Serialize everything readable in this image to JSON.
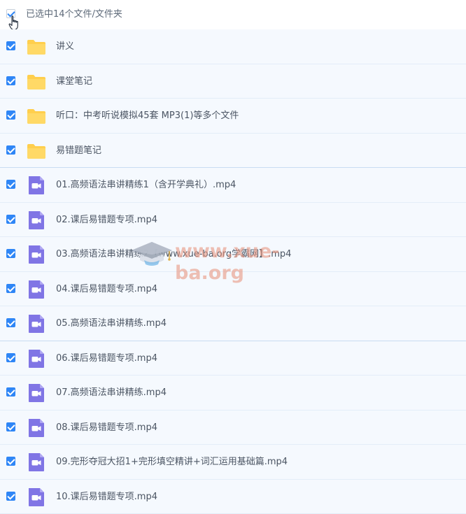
{
  "header": {
    "selection_label": "已选中14个文件/文件夹"
  },
  "items": [
    {
      "name": "讲义",
      "type": "folder"
    },
    {
      "name": "课堂笔记",
      "type": "folder"
    },
    {
      "name": "听口：中考听说模拟45套 MP3(1)等多个文件",
      "type": "folder"
    },
    {
      "name": "易错题笔记",
      "type": "folder"
    },
    {
      "name": "01.高频语法串讲精练1（含开学典礼）.mp4",
      "type": "video"
    },
    {
      "name": "02.课后易错题专项.mp4",
      "type": "video"
    },
    {
      "name": "03.高频语法串讲精练2【www.xue-ba.org学霸网】.mp4",
      "type": "video"
    },
    {
      "name": "04.课后易错题专项.mp4",
      "type": "video"
    },
    {
      "name": "05.高频语法串讲精练.mp4",
      "type": "video"
    },
    {
      "name": "06.课后易错题专项.mp4",
      "type": "video"
    },
    {
      "name": "07.高频语法串讲精练.mp4",
      "type": "video"
    },
    {
      "name": "08.课后易错题专项.mp4",
      "type": "video"
    },
    {
      "name": "09.完形夺冠大招1+完形填空精讲+词汇运用基础篇.mp4",
      "type": "video"
    },
    {
      "name": "10.课后易错题专项.mp4",
      "type": "video"
    }
  ],
  "watermark": {
    "text": "www.xue-ba.org"
  },
  "colors": {
    "accent": "#2f86f6",
    "row_bg": "#f5f9fe",
    "folder": "#ffd35a",
    "video": "#8075e5"
  },
  "icons": {
    "folder": "folder-icon",
    "video": "video-file-icon",
    "cursor": "hand-pointer-icon"
  }
}
